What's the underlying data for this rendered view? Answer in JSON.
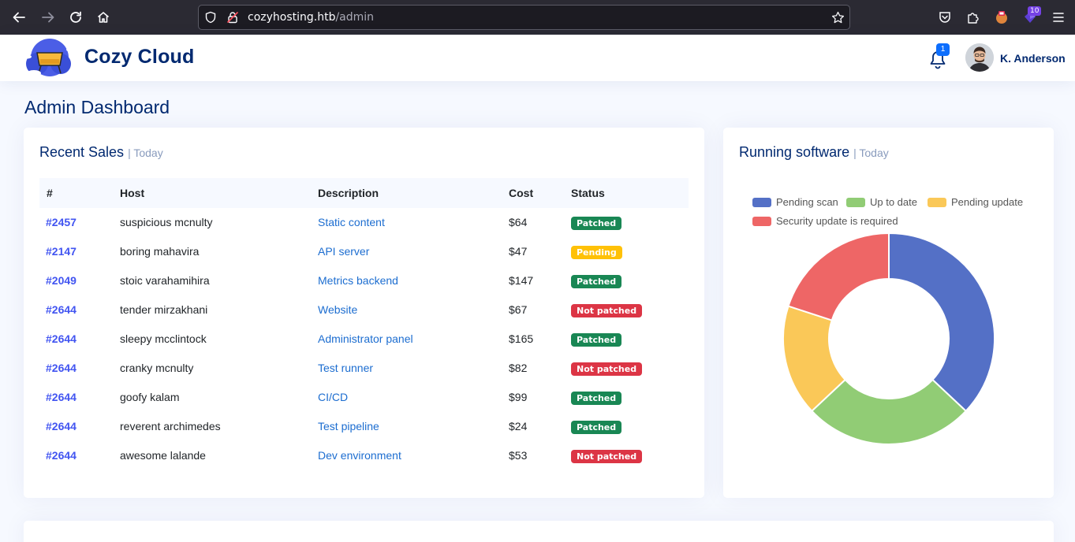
{
  "browser": {
    "url_host": "cozyhosting.htb",
    "url_path": "/admin",
    "extension_badge": "10"
  },
  "header": {
    "brand": "Cozy Cloud",
    "notification_count": "1",
    "user_name": "K. Anderson"
  },
  "page": {
    "title": "Admin Dashboard"
  },
  "sales": {
    "title": "Recent Sales",
    "subtitle": "| Today",
    "columns": [
      "#",
      "Host",
      "Description",
      "Cost",
      "Status"
    ],
    "rows": [
      {
        "id": "#2457",
        "host": "suspicious mcnulty",
        "description": "Static content",
        "cost": "$64",
        "status": "Patched",
        "status_kind": "patched"
      },
      {
        "id": "#2147",
        "host": "boring mahavira",
        "description": "API server",
        "cost": "$47",
        "status": "Pending",
        "status_kind": "pending"
      },
      {
        "id": "#2049",
        "host": "stoic varahamihira",
        "description": "Metrics backend",
        "cost": "$147",
        "status": "Patched",
        "status_kind": "patched"
      },
      {
        "id": "#2644",
        "host": "tender mirzakhani",
        "description": "Website",
        "cost": "$67",
        "status": "Not patched",
        "status_kind": "not-patched"
      },
      {
        "id": "#2644",
        "host": "sleepy mcclintock",
        "description": "Administrator panel",
        "cost": "$165",
        "status": "Patched",
        "status_kind": "patched"
      },
      {
        "id": "#2644",
        "host": "cranky mcnulty",
        "description": "Test runner",
        "cost": "$82",
        "status": "Not patched",
        "status_kind": "not-patched"
      },
      {
        "id": "#2644",
        "host": "goofy kalam",
        "description": "CI/CD",
        "cost": "$99",
        "status": "Patched",
        "status_kind": "patched"
      },
      {
        "id": "#2644",
        "host": "reverent archimedes",
        "description": "Test pipeline",
        "cost": "$24",
        "status": "Patched",
        "status_kind": "patched"
      },
      {
        "id": "#2644",
        "host": "awesome lalande",
        "description": "Dev environment",
        "cost": "$53",
        "status": "Not patched",
        "status_kind": "not-patched"
      }
    ]
  },
  "software": {
    "title": "Running software",
    "subtitle": "| Today"
  },
  "chart_data": {
    "type": "pie",
    "title": "",
    "categories": [
      "Pending scan",
      "Up to date",
      "Pending update",
      "Security update is required"
    ],
    "values": [
      37,
      26,
      17,
      20
    ],
    "colors": [
      "#5470c6",
      "#91cc75",
      "#fac858",
      "#ee6666"
    ],
    "legend": "top",
    "donut": true
  }
}
